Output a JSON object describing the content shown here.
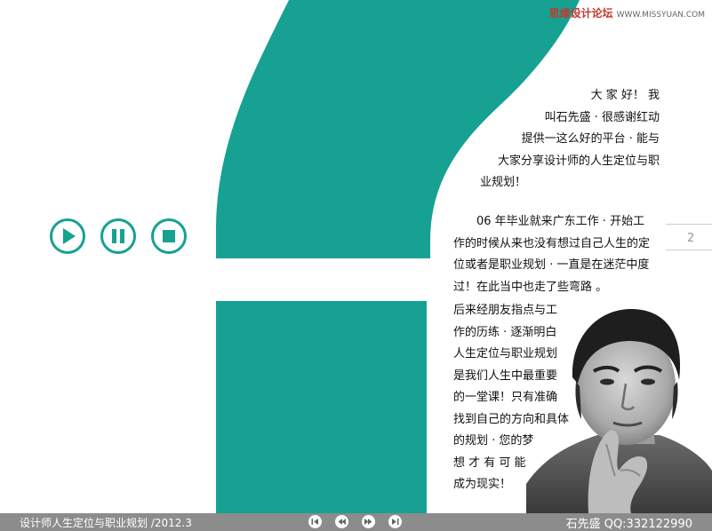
{
  "watermark": {
    "site_name": "思缘设计论坛",
    "site_url": "WWW.MISSYUAN.COM"
  },
  "colors": {
    "accent": "#16a192",
    "footer_bg": "#8c8c8c"
  },
  "player": {
    "play_icon": "play-icon",
    "pause_icon": "pause-icon",
    "stop_icon": "stop-icon"
  },
  "page_number": "2",
  "intro": {
    "lines": [
      "大 家 好！ 我",
      "叫石先盛 · 很感谢红动",
      "提供一这么好的平台 · 能与",
      "大家分享设计师的人生定位与职",
      "业规划！"
    ]
  },
  "story": {
    "lines": [
      "06 年毕业就来广东工作 · 开始工",
      "作的时候从来也没有想过自己人生的定",
      "位或者是职业规划 · 一直是在迷茫中度",
      "过！在此当中也走了些弯路 。"
    ]
  },
  "reflection": {
    "lines": [
      "后来经朋友指点与工",
      "作的历练 · 逐渐明白",
      "人生定位与职业规划",
      "是我们人生中最重要",
      "的一堂课！只有准确",
      "找到自己的方向和具体",
      "的规划 · 您的梦",
      "想 才 有 可 能",
      "成为现实！"
    ]
  },
  "footer": {
    "title": "设计师人生定位与职业规划 /2012.3",
    "author": "石先盛 QQ:332122990",
    "nav_icons": [
      "first-page-icon",
      "previous-page-icon",
      "next-page-icon",
      "last-page-icon"
    ]
  }
}
